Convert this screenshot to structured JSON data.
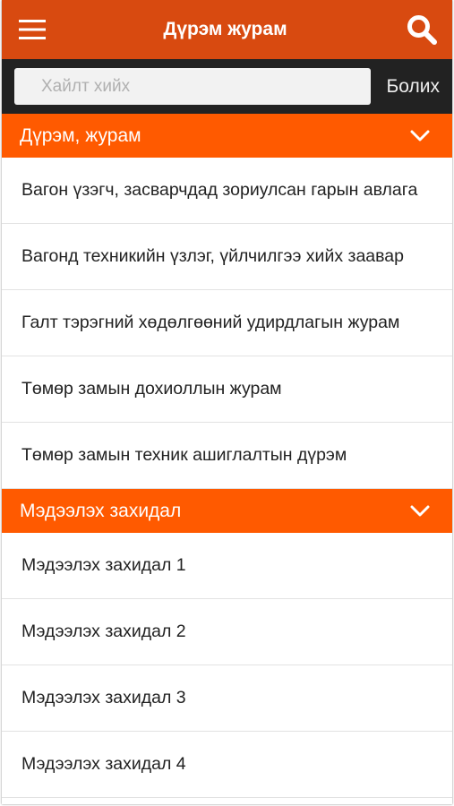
{
  "appbar": {
    "title": "Дүрэм журам",
    "menu_icon": "hamburger-menu-icon",
    "search_icon": "search-icon",
    "bg_color": "#D84A10"
  },
  "search": {
    "placeholder": "Хайлт хийх",
    "value": "",
    "cancel_label": "Болих"
  },
  "sections": [
    {
      "title": "Дүрэм, журам",
      "expanded": true,
      "items": [
        "Вагон үзэгч, засварчдад зориулсан гарын авлага",
        "Вагонд техникийн үзлэг, үйлчилгээ хийх заавар",
        "Галт тэрэгний хөдөлгөөний удирдлагын журам",
        "Төмөр замын дохиоллын журам",
        "Төмөр замын техник ашиглалтын дүрэм"
      ]
    },
    {
      "title": "Мэдээлэх захидал",
      "expanded": true,
      "items": [
        "Мэдээлэх захидал 1",
        "Мэдээлэх захидал 2",
        "Мэдээлэх захидал 3",
        "Мэдээлэх захидал 4"
      ]
    }
  ],
  "colors": {
    "section_header": "#FF5A00",
    "search_bar": "#222222",
    "divider": "#e2e2e2"
  }
}
